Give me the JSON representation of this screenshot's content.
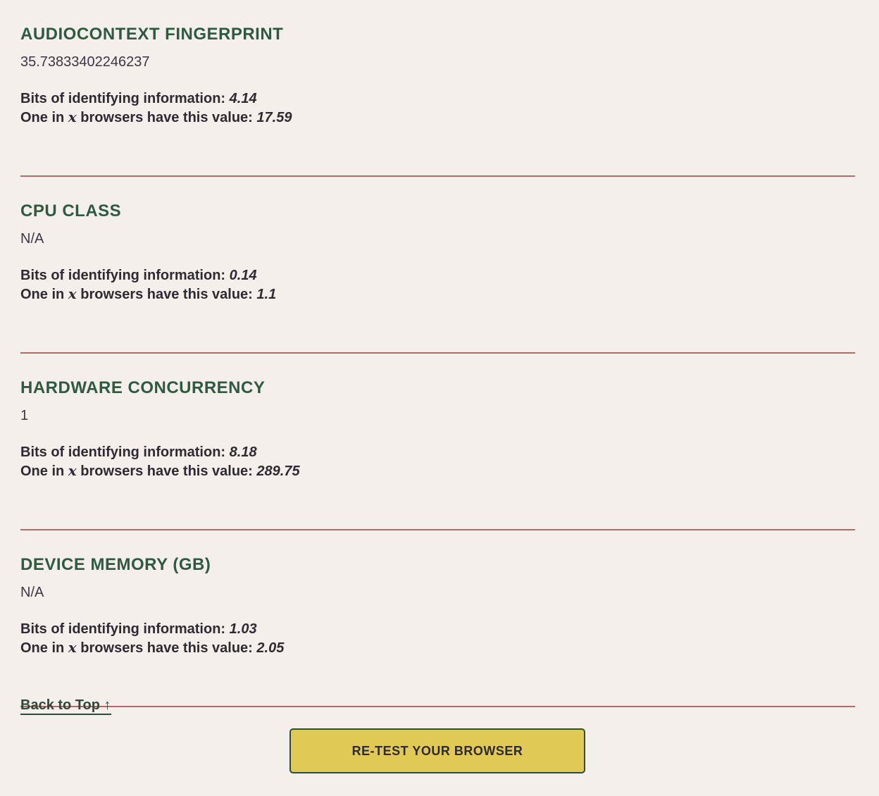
{
  "stats_labels": {
    "bits": "Bits of identifying information:",
    "one_in_prefix": "One in",
    "x": "x",
    "one_in_suffix": "browsers have this value:"
  },
  "sections": [
    {
      "title": "AUDIOCONTEXT FINGERPRINT",
      "value": "35.73833402246237",
      "bits": "4.14",
      "one_in_x": "17.59"
    },
    {
      "title": "CPU CLASS",
      "value": "N/A",
      "bits": "0.14",
      "one_in_x": "1.1"
    },
    {
      "title": "HARDWARE CONCURRENCY",
      "value": "1",
      "bits": "8.18",
      "one_in_x": "289.75"
    },
    {
      "title": "DEVICE MEMORY (GB)",
      "value": "N/A",
      "bits": "1.03",
      "one_in_x": "2.05"
    }
  ],
  "back_to_top": "Back to Top ↑",
  "retest_button": "RE-TEST YOUR BROWSER"
}
